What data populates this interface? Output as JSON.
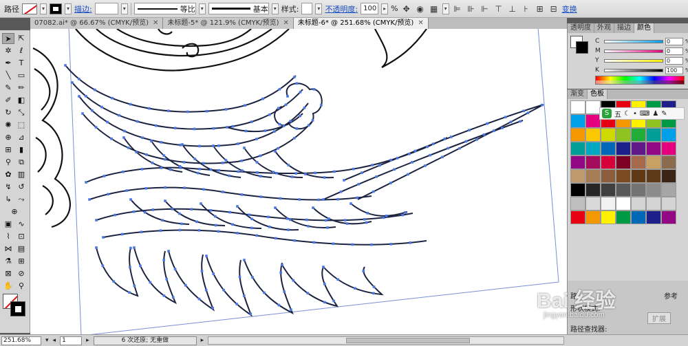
{
  "control_bar": {
    "object_type": "路径",
    "stroke_label": "描边:",
    "stroke_value": "",
    "profile_label": "等比",
    "brush_label": "基本",
    "style_label": "样式:",
    "opacity_label": "不透明度:",
    "opacity_value": "100",
    "opacity_unit": "%",
    "transform_label": "变换"
  },
  "tabs": [
    {
      "label": "07082.ai* @ 66.67% (CMYK/预览)"
    },
    {
      "label": "未标题-5* @ 121.9% (CMYK/预览)"
    },
    {
      "label": "未标题-6* @ 251.68% (CMYK/预览)",
      "active": true
    }
  ],
  "color_panel": {
    "tabs": [
      "透明度",
      "外观",
      "描边",
      "颜色"
    ],
    "channels": [
      {
        "label": "C",
        "value": "0",
        "unit": "%"
      },
      {
        "label": "M",
        "value": "0",
        "unit": "%"
      },
      {
        "label": "Y",
        "value": "0",
        "unit": "%"
      },
      {
        "label": "K",
        "value": "100",
        "unit": "%"
      }
    ]
  },
  "swatches_panel": {
    "tabs": [
      "渐变",
      "色板"
    ],
    "ime_text": "五",
    "colors": [
      "#ffffff",
      "#ffffff",
      "#000000",
      "#e60012",
      "#fff100",
      "#009944",
      "#1d2088",
      "#00a0e9",
      "#e4007f",
      "#e60012",
      "#f39800",
      "#fff100",
      "#8fc31f",
      "#009944",
      "#f39800",
      "#fcc800",
      "#cfdb00",
      "#8fc31f",
      "#22ac38",
      "#009e96",
      "#00a0e9",
      "#009e96",
      "#00a7c1",
      "#0068b7",
      "#1d2088",
      "#601986",
      "#920783",
      "#e4007f",
      "#920783",
      "#a40b5d",
      "#d7003a",
      "#7e0023",
      "#a66a4a",
      "#c8a063",
      "#8a6b4e",
      "#be9a6b",
      "#a67c52",
      "#8c5e3c",
      "#7b4a1e",
      "#603813",
      "#5e3a1a",
      "#3c2415",
      "#000000",
      "#262626",
      "#3f3f3f",
      "#595959",
      "#737373",
      "#8c8c8c",
      "#a6a6a6",
      "#bfbfbf",
      "#d9d9d9",
      "#f2f2f2",
      "#ffffff",
      "#d4d4d4",
      "#d4d4d4",
      "#d4d4d4",
      "#e60012",
      "#f39800",
      "#fff100",
      "#009944",
      "#0068b7",
      "#1d2088",
      "#920783"
    ]
  },
  "bottom_panel": {
    "tab_left": "路",
    "tab_right": "参考",
    "item1": "形状模式:",
    "button": "扩展",
    "item2": "路径查找器:"
  },
  "status_bar": {
    "zoom": "251.68%",
    "page": "1",
    "status": "6 次还原; 无重做"
  },
  "watermark": {
    "main": "Bai 经验",
    "sub": "jingyan.baidu.com"
  }
}
